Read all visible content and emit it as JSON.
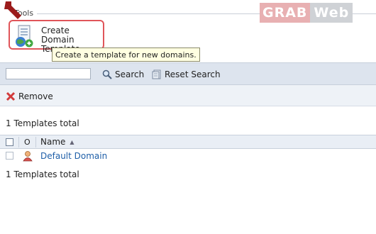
{
  "tools": {
    "section_title": "Tools",
    "create_template": {
      "label_line1": "Create Domain",
      "label_line2": "Template",
      "tooltip": "Create a template for new domains."
    }
  },
  "watermark": {
    "part1": "GRAB",
    "part2": "Web"
  },
  "search": {
    "value": "",
    "button_label": "Search",
    "reset_label": "Reset Search"
  },
  "actions": {
    "remove_label": "Remove"
  },
  "summary": {
    "top": "1 Templates total",
    "bottom": "1 Templates total"
  },
  "table": {
    "headers": {
      "o": "O",
      "name": "Name"
    },
    "rows": [
      {
        "name": "Default Domain"
      }
    ]
  },
  "colors": {
    "highlight": "#e0555a",
    "link": "#1f5fa8",
    "toolbar_bg": "#dde4ee",
    "tooltip_bg": "#ffffe1"
  },
  "icons": [
    "arrow-pointer-icon",
    "create-template-icon",
    "search-icon",
    "reset-search-icon",
    "remove-icon",
    "domain-template-icon"
  ]
}
